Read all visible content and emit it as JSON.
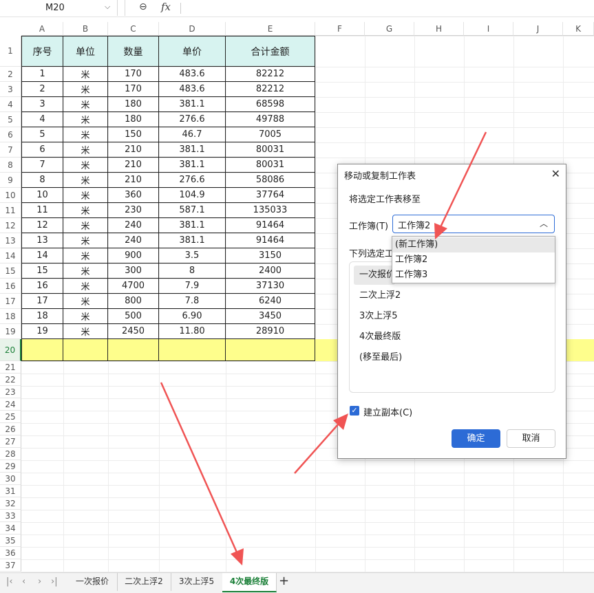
{
  "namebox": {
    "value": "M20"
  },
  "formula_bar": {
    "zoom_icon": "zoom-out-icon",
    "fx_label": "fx",
    "value": ""
  },
  "columns": [
    "A",
    "B",
    "C",
    "D",
    "E",
    "F",
    "G",
    "H",
    "I",
    "J",
    "K"
  ],
  "rows": [
    "1",
    "2",
    "3",
    "4",
    "5",
    "6",
    "7",
    "8",
    "9",
    "10",
    "11",
    "12",
    "13",
    "14",
    "15",
    "16",
    "17",
    "18",
    "19",
    "20",
    "21",
    "22",
    "23",
    "24",
    "25",
    "26",
    "27",
    "28",
    "29",
    "30",
    "31",
    "32",
    "33",
    "34",
    "35",
    "36",
    "37"
  ],
  "selected_row": "20",
  "table": {
    "headers": [
      "序号",
      "单位",
      "数量",
      "单价",
      "合计金额"
    ],
    "rows": [
      [
        "1",
        "米",
        "170",
        "483.6",
        "82212"
      ],
      [
        "2",
        "米",
        "170",
        "483.6",
        "82212"
      ],
      [
        "3",
        "米",
        "180",
        "381.1",
        "68598"
      ],
      [
        "4",
        "米",
        "180",
        "276.6",
        "49788"
      ],
      [
        "5",
        "米",
        "150",
        "46.7",
        "7005"
      ],
      [
        "6",
        "米",
        "210",
        "381.1",
        "80031"
      ],
      [
        "7",
        "米",
        "210",
        "381.1",
        "80031"
      ],
      [
        "8",
        "米",
        "210",
        "276.6",
        "58086"
      ],
      [
        "10",
        "米",
        "360",
        "104.9",
        "37764"
      ],
      [
        "11",
        "米",
        "230",
        "587.1",
        "135033"
      ],
      [
        "12",
        "米",
        "240",
        "381.1",
        "91464"
      ],
      [
        "13",
        "米",
        "240",
        "381.1",
        "91464"
      ],
      [
        "14",
        "米",
        "900",
        "3.5",
        "3150"
      ],
      [
        "15",
        "米",
        "300",
        "8",
        "2400"
      ],
      [
        "16",
        "米",
        "4700",
        "7.9",
        "37130"
      ],
      [
        "17",
        "米",
        "800",
        "7.8",
        "6240"
      ],
      [
        "18",
        "米",
        "500",
        "6.90",
        "3450"
      ],
      [
        "19",
        "米",
        "2450",
        "11.80",
        "28910"
      ]
    ]
  },
  "dialog": {
    "title": "移动或复制工作表",
    "move_to_label": "将选定工作表移至",
    "workbook_label": "工作簿(T)",
    "workbook_value": "工作簿2",
    "before_label": "下列选定工",
    "sheets": [
      "一次报价",
      "二次上浮2",
      "3次上浮5",
      "4次最终版",
      "(移至最后)"
    ],
    "copy_checkbox_label": "建立副本(C)",
    "copy_checked": true,
    "ok_label": "确定",
    "cancel_label": "取消"
  },
  "dropdown": {
    "options": [
      "(新工作簿)",
      "工作簿2",
      "工作簿3"
    ],
    "highlighted": 0
  },
  "sheet_tabs": {
    "tabs": [
      "一次报价",
      "二次上浮2",
      "3次上浮5",
      "4次最终版"
    ],
    "active": 3,
    "add_label": "+"
  },
  "colors": {
    "accent": "#2c6bd6",
    "header_fill": "#d7f3f0",
    "highlight_fill": "#fefe8c",
    "active_tab": "#1a7f37",
    "arrow": "#f05454"
  }
}
